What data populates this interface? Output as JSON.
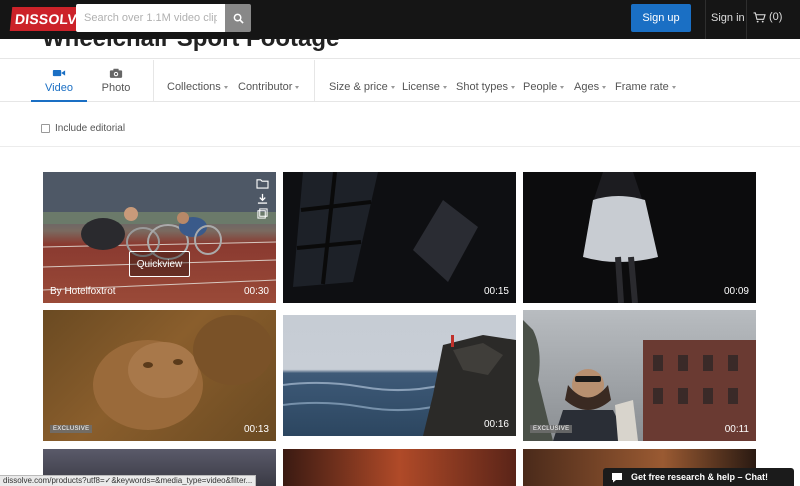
{
  "header": {
    "logo_text": "DISSOLVE",
    "search_placeholder": "Search over 1.1M video clips",
    "signup_label": "Sign up",
    "signin_label": "Sign in",
    "cart_count": "(0)",
    "brand_color": "#cc2229",
    "accent_color": "#1a6fc4"
  },
  "page_heading": "Wheelchair Sport Footage",
  "media_tabs": [
    {
      "label": "Video",
      "icon": "video-camera-icon",
      "active": true
    },
    {
      "label": "Photo",
      "icon": "camera-icon",
      "active": false
    }
  ],
  "filters": {
    "group1": [
      "Collections",
      "Contributor"
    ],
    "group2": [
      "Size & price",
      "License",
      "Shot types",
      "People",
      "Ages",
      "Frame rate"
    ]
  },
  "editorial_label": "Include editorial",
  "clips": [
    {
      "duration": "00:30",
      "by": "By Hotelfoxtrot",
      "badge": "",
      "quickview": "Quickview",
      "hovered": true
    },
    {
      "duration": "00:15",
      "by": "",
      "badge": ""
    },
    {
      "duration": "00:09",
      "by": "",
      "badge": ""
    },
    {
      "duration": "00:13",
      "by": "",
      "badge": "EXCLUSIVE"
    },
    {
      "duration": "00:16",
      "by": "",
      "badge": ""
    },
    {
      "duration": "00:11",
      "by": "",
      "badge": "EXCLUSIVE"
    }
  ],
  "status_url": "dissolve.com/products?utf8=✓&keywords=&media_type=video&filter...",
  "chat_label": "Get free research & help – Chat!"
}
